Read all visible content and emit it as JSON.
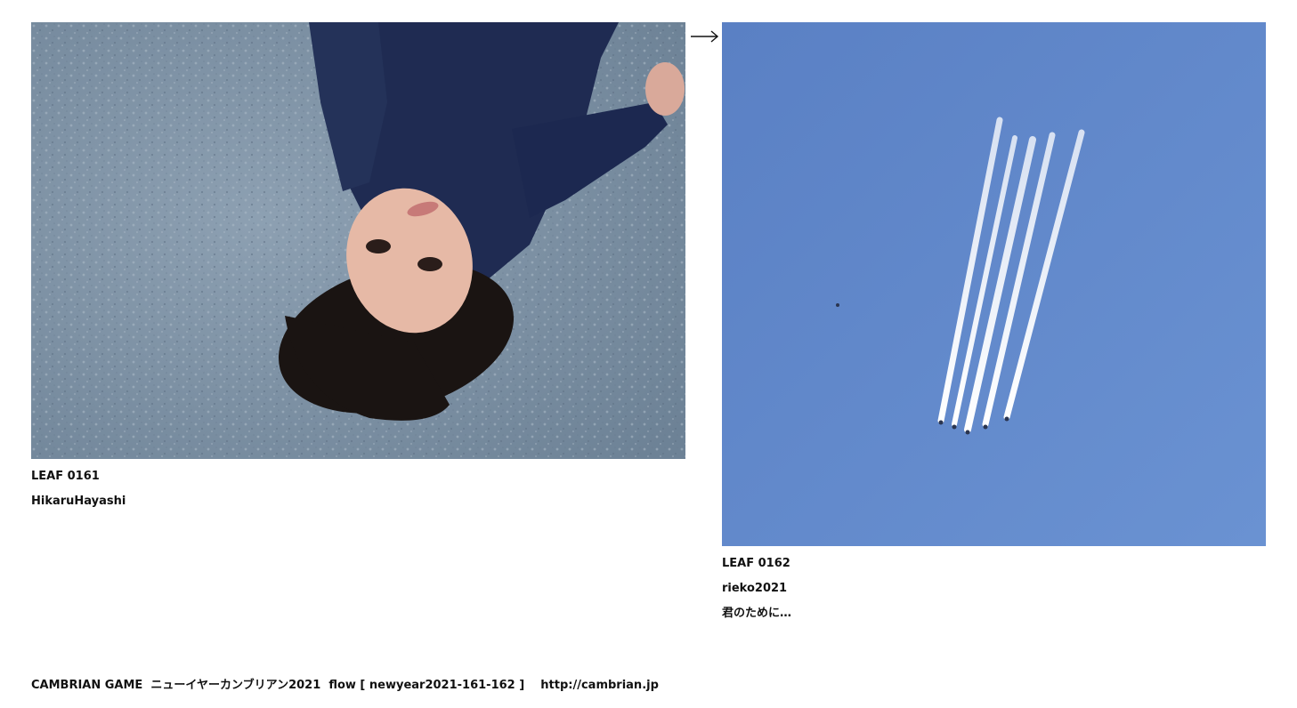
{
  "leaves": [
    {
      "id": "LEAF 0161",
      "author": "HikaruHayashi",
      "comment": ""
    },
    {
      "id": "LEAF 0162",
      "author": "rieko2021",
      "comment": "君のために…"
    }
  ],
  "arrow": "→",
  "footer": {
    "game": "CAMBRIAN GAME",
    "event": "ニューイヤーカンブリアン2021",
    "flow": "flow [ newyear2021-161-162 ]",
    "url": "http://cambrian.jp"
  },
  "colors": {
    "asphalt": "#7f93a6",
    "sweater": "#1f2b52",
    "sky": "#5d86c9",
    "contrail": "#f4f6fb"
  }
}
